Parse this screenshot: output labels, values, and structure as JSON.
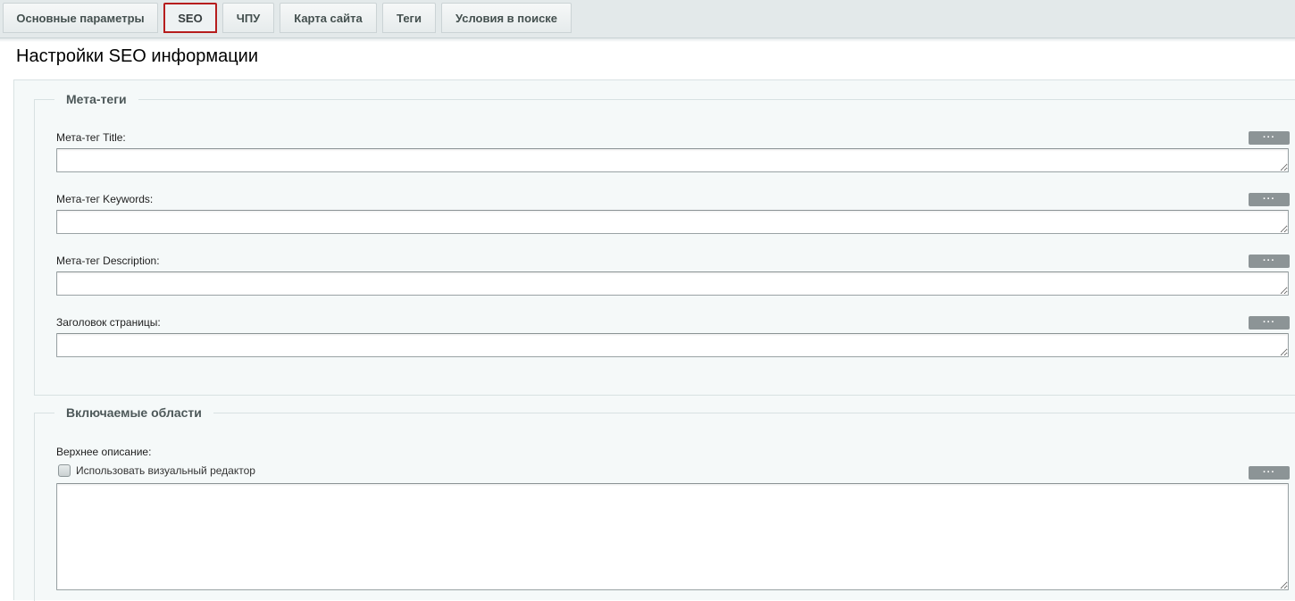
{
  "tabs": [
    {
      "label": "Основные параметры",
      "active": false
    },
    {
      "label": "SEO",
      "active": true
    },
    {
      "label": "ЧПУ",
      "active": false
    },
    {
      "label": "Карта сайта",
      "active": false
    },
    {
      "label": "Теги",
      "active": false
    },
    {
      "label": "Условия в поиске",
      "active": false
    }
  ],
  "page_title": "Настройки SEO информации",
  "meta_group": {
    "legend": "Мета-теги",
    "fields": [
      {
        "label": "Мета-тег Title:",
        "value": "",
        "button": "···"
      },
      {
        "label": "Мета-тег Keywords:",
        "value": "",
        "button": "···"
      },
      {
        "label": "Мета-тег Description:",
        "value": "",
        "button": "···"
      },
      {
        "label": "Заголовок страницы:",
        "value": "",
        "button": "···"
      }
    ]
  },
  "include_group": {
    "legend": "Включаемые области",
    "top_description_label": "Верхнее описание:",
    "visual_editor_label": "Использовать визуальный редактор",
    "visual_editor_checked": false,
    "button": "···",
    "value": ""
  },
  "colors": {
    "active_tab_border": "#b61d1d",
    "dots_button": "#8c9496",
    "panel_background": "#f5f9f9"
  }
}
